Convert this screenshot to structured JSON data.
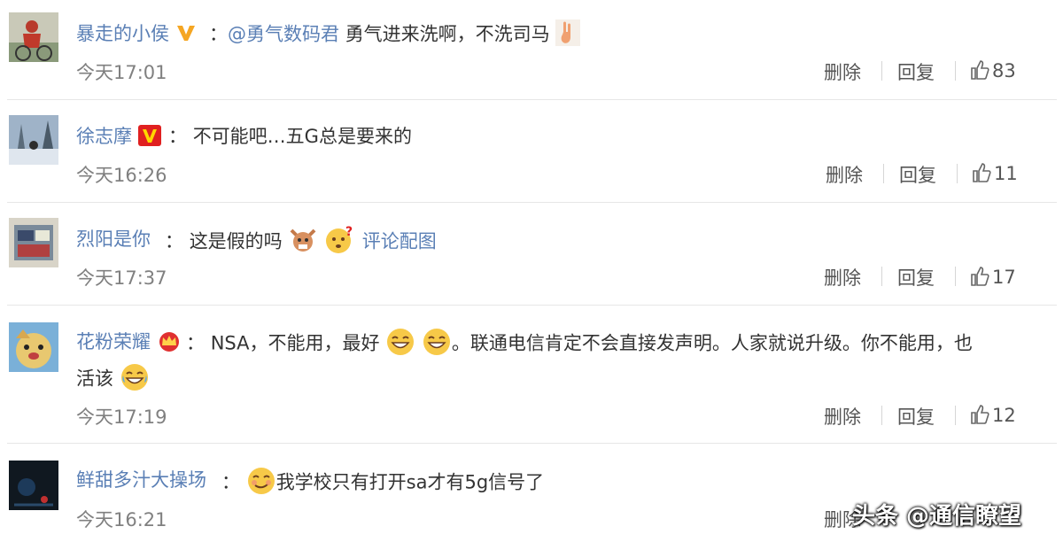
{
  "comments": [
    {
      "username": "暴走的小侯",
      "colon": "：",
      "mention": "@勇气数码君",
      "text": "勇气进来洗啊，不洗司马",
      "time": "今天17:01",
      "delete_label": "删除",
      "reply_label": "回复",
      "likes": "83"
    },
    {
      "username": "徐志摩",
      "colon": "：",
      "text": "不可能吧…五G总是要来的",
      "time": "今天16:26",
      "delete_label": "删除",
      "reply_label": "回复",
      "likes": "11"
    },
    {
      "username": "烈阳是你",
      "colon": "：",
      "text": "这是假的吗",
      "image_link": "评论配图",
      "time": "今天17:37",
      "delete_label": "删除",
      "reply_label": "回复",
      "likes": "17"
    },
    {
      "username": "花粉荣耀",
      "colon": "：",
      "text_a": "NSA，不能用，最好",
      "text_b": "。联通电信肯定不会直接发声明。人家就说升级。你不能用，也",
      "text_c": "活该",
      "time": "今天17:19",
      "delete_label": "删除",
      "reply_label": "回复",
      "likes": "12"
    },
    {
      "username": "鲜甜多汁大操场",
      "colon": "：",
      "text": "我学校只有打开sa才有5g信号了",
      "time": "今天16:21",
      "delete_label": "删除"
    }
  ],
  "watermark": "头条 @通信瞭望",
  "colors": {
    "username": "#5a7fb5",
    "text": "#333333",
    "muted": "#808080",
    "separator": "#e6e6e6",
    "verified_orange": "#f5a623",
    "verified_red": "#e02020"
  },
  "icons": [
    "thumbs-up-icon",
    "verified-v-icon",
    "crown-icon",
    "grin-emoji",
    "laugh-cry-emoji",
    "smirk-emoji",
    "hand-emoji"
  ]
}
